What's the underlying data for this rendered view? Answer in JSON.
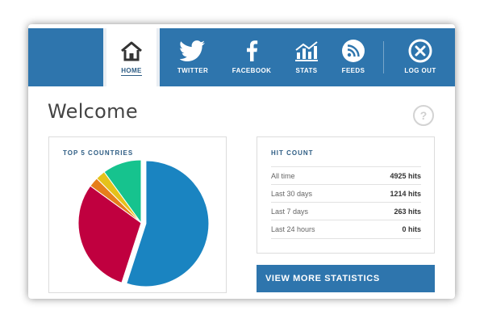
{
  "nav": {
    "items": [
      {
        "key": "home",
        "label": "HOME",
        "icon": "home-icon",
        "active": true
      },
      {
        "key": "twitter",
        "label": "TWITTER",
        "icon": "twitter-bird-icon"
      },
      {
        "key": "facebook",
        "label": "FACEBOOK",
        "icon": "facebook-f-icon"
      },
      {
        "key": "stats",
        "label": "STATS",
        "icon": "stats-chart-icon"
      },
      {
        "key": "feeds",
        "label": "FEEDS",
        "icon": "rss-icon"
      },
      {
        "key": "logout",
        "label": "LOG OUT",
        "icon": "close-circle-icon"
      }
    ]
  },
  "page": {
    "title": "Welcome",
    "help_icon": "?"
  },
  "countries": {
    "title": "TOP 5 COUNTRIES",
    "chart_data": {
      "type": "pie",
      "title": "TOP 5 COUNTRIES",
      "slices": [
        {
          "value": 55,
          "color": "#1a84c1"
        },
        {
          "value": 30,
          "color": "#c0003f"
        },
        {
          "value": 2.5,
          "color": "#e67e1c"
        },
        {
          "value": 2.5,
          "color": "#e5c21a"
        },
        {
          "value": 10,
          "color": "#16c38e"
        }
      ]
    }
  },
  "hits": {
    "title": "HIT COUNT",
    "rows": [
      {
        "label": "All time",
        "value": "4925 hits"
      },
      {
        "label": "Last 30 days",
        "value": "1214 hits"
      },
      {
        "label": "Last 7 days",
        "value": "263 hits"
      },
      {
        "label": "Last 24 hours",
        "value": "0 hits"
      }
    ]
  },
  "actions": {
    "view_more": "VIEW MORE STATISTICS"
  },
  "colors": {
    "nav_bg": "#2e75ad",
    "accent": "#2e5d84"
  }
}
